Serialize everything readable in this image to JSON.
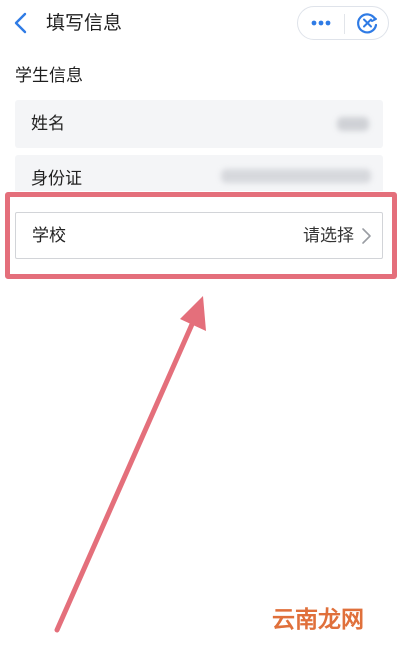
{
  "header": {
    "title": "填写信息",
    "back_icon": "chevron-left-icon",
    "more_icon": "more-dots-icon",
    "close_icon": "close-circle-icon",
    "accent_color": "#2f7be5"
  },
  "section": {
    "title": "学生信息"
  },
  "form": {
    "name_label": "姓名",
    "id_label": "身份证",
    "school_label": "学校",
    "school_placeholder": "请选择"
  },
  "annotation": {
    "highlight_color": "#e46f7b",
    "arrow_color": "#e46f7b"
  },
  "watermark": {
    "text": "云南龙网",
    "color": "#e0703b"
  }
}
